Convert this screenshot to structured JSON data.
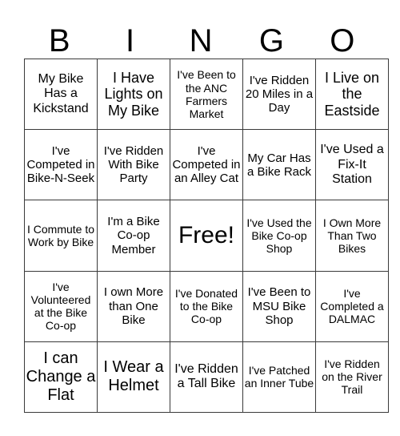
{
  "header": {
    "letters": [
      "B",
      "I",
      "N",
      "G",
      "O"
    ]
  },
  "board": {
    "rows": [
      [
        "My Bike Has a Kickstand",
        "I Have Lights on My Bike",
        "I've Been to the ANC Farmers Market",
        "I've Ridden 20 Miles in a Day",
        "I Live on the Eastside"
      ],
      [
        "I've Competed in Bike-N-Seek",
        "I've Ridden With Bike Party",
        "I've Competed in an Alley Cat",
        "My Car Has a Bike Rack",
        "I've Used a Fix-It Station"
      ],
      [
        "I Commute to Work by Bike",
        "I'm a Bike Co-op Member",
        "Free!",
        "I've Used the Bike Co-op Shop",
        "I Own More Than Two Bikes"
      ],
      [
        "I've Volunteered at the Bike Co-op",
        "I own More than One Bike",
        "I've Donated to the Bike Co-op",
        "I've Been to MSU Bike Shop",
        "I've Completed a DALMAC"
      ],
      [
        "I can Change a Flat",
        "I Wear a Helmet",
        "I've Ridden a Tall Bike",
        "I've Patched an Inner Tube",
        "I've Ridden on the River Trail"
      ]
    ]
  }
}
